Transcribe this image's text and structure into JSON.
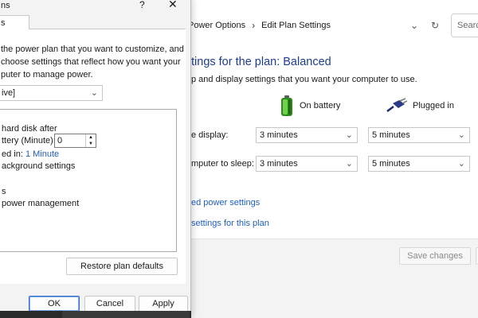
{
  "window": {
    "breadcrumb": [
      "Power Options",
      "Edit Plan Settings"
    ],
    "search_placeholder": "Search",
    "plan_title": "tings for the plan: Balanced",
    "plan_desc": "p and display settings that you want your computer to use.",
    "columns": {
      "on_battery": "On battery",
      "plugged_in": "Plugged in"
    },
    "rows": [
      {
        "label": "e display:",
        "battery": "3 minutes",
        "plugged": "5 minutes"
      },
      {
        "label": "mputer to sleep:",
        "battery": "3 minutes",
        "plugged": "5 minutes"
      }
    ],
    "links": {
      "advanced": "ed power settings",
      "restore": "settings for this plan"
    },
    "save_label": "Save changes",
    "icons": {
      "back": "chevron-down-icon",
      "refresh": "refresh-icon",
      "battery": "battery-icon",
      "plug": "plug-icon"
    }
  },
  "dialog": {
    "title": "ns",
    "tab_label": "s",
    "description": "the power plan that you want to customize, and choose settings that reflect how you want your uter to manage power.",
    "desc_lines": [
      "the power plan that you want to customize, and",
      "choose settings that reflect how you want your",
      "puter to manage power."
    ],
    "plan_value": "ive]",
    "tree": [
      {
        "text": "hard disk after",
        "indent": 0
      },
      {
        "text": "ttery (Minute):",
        "indent": 0
      },
      {
        "text": "ed in:",
        "link": "1 Minute",
        "indent": 0
      },
      {
        "text": "ackground settings",
        "indent": 0
      },
      {
        "text": "s",
        "indent": 0
      },
      {
        "text": "power management",
        "indent": 0
      }
    ],
    "spin_value": "0",
    "restore_label": "Restore plan defaults",
    "ok_label": "OK",
    "cancel_label": "Cancel",
    "apply_label": "Apply"
  }
}
